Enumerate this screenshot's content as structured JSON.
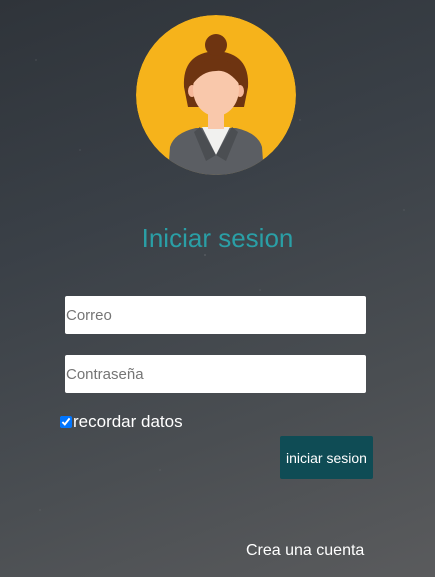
{
  "avatar": {
    "icon": "user-avatar-icon",
    "bg_color": "#f6b31b"
  },
  "login": {
    "title": "Iniciar sesion",
    "title_color": "#2a9fa6",
    "email_placeholder": "Correo",
    "email_value": "",
    "password_placeholder": "Contraseña",
    "password_value": "",
    "remember_label": "recordar datos",
    "remember_checked": true,
    "submit_label": "iniciar sesion",
    "submit_color": "#0f4c55",
    "create_account_label": "Crea una cuenta"
  }
}
